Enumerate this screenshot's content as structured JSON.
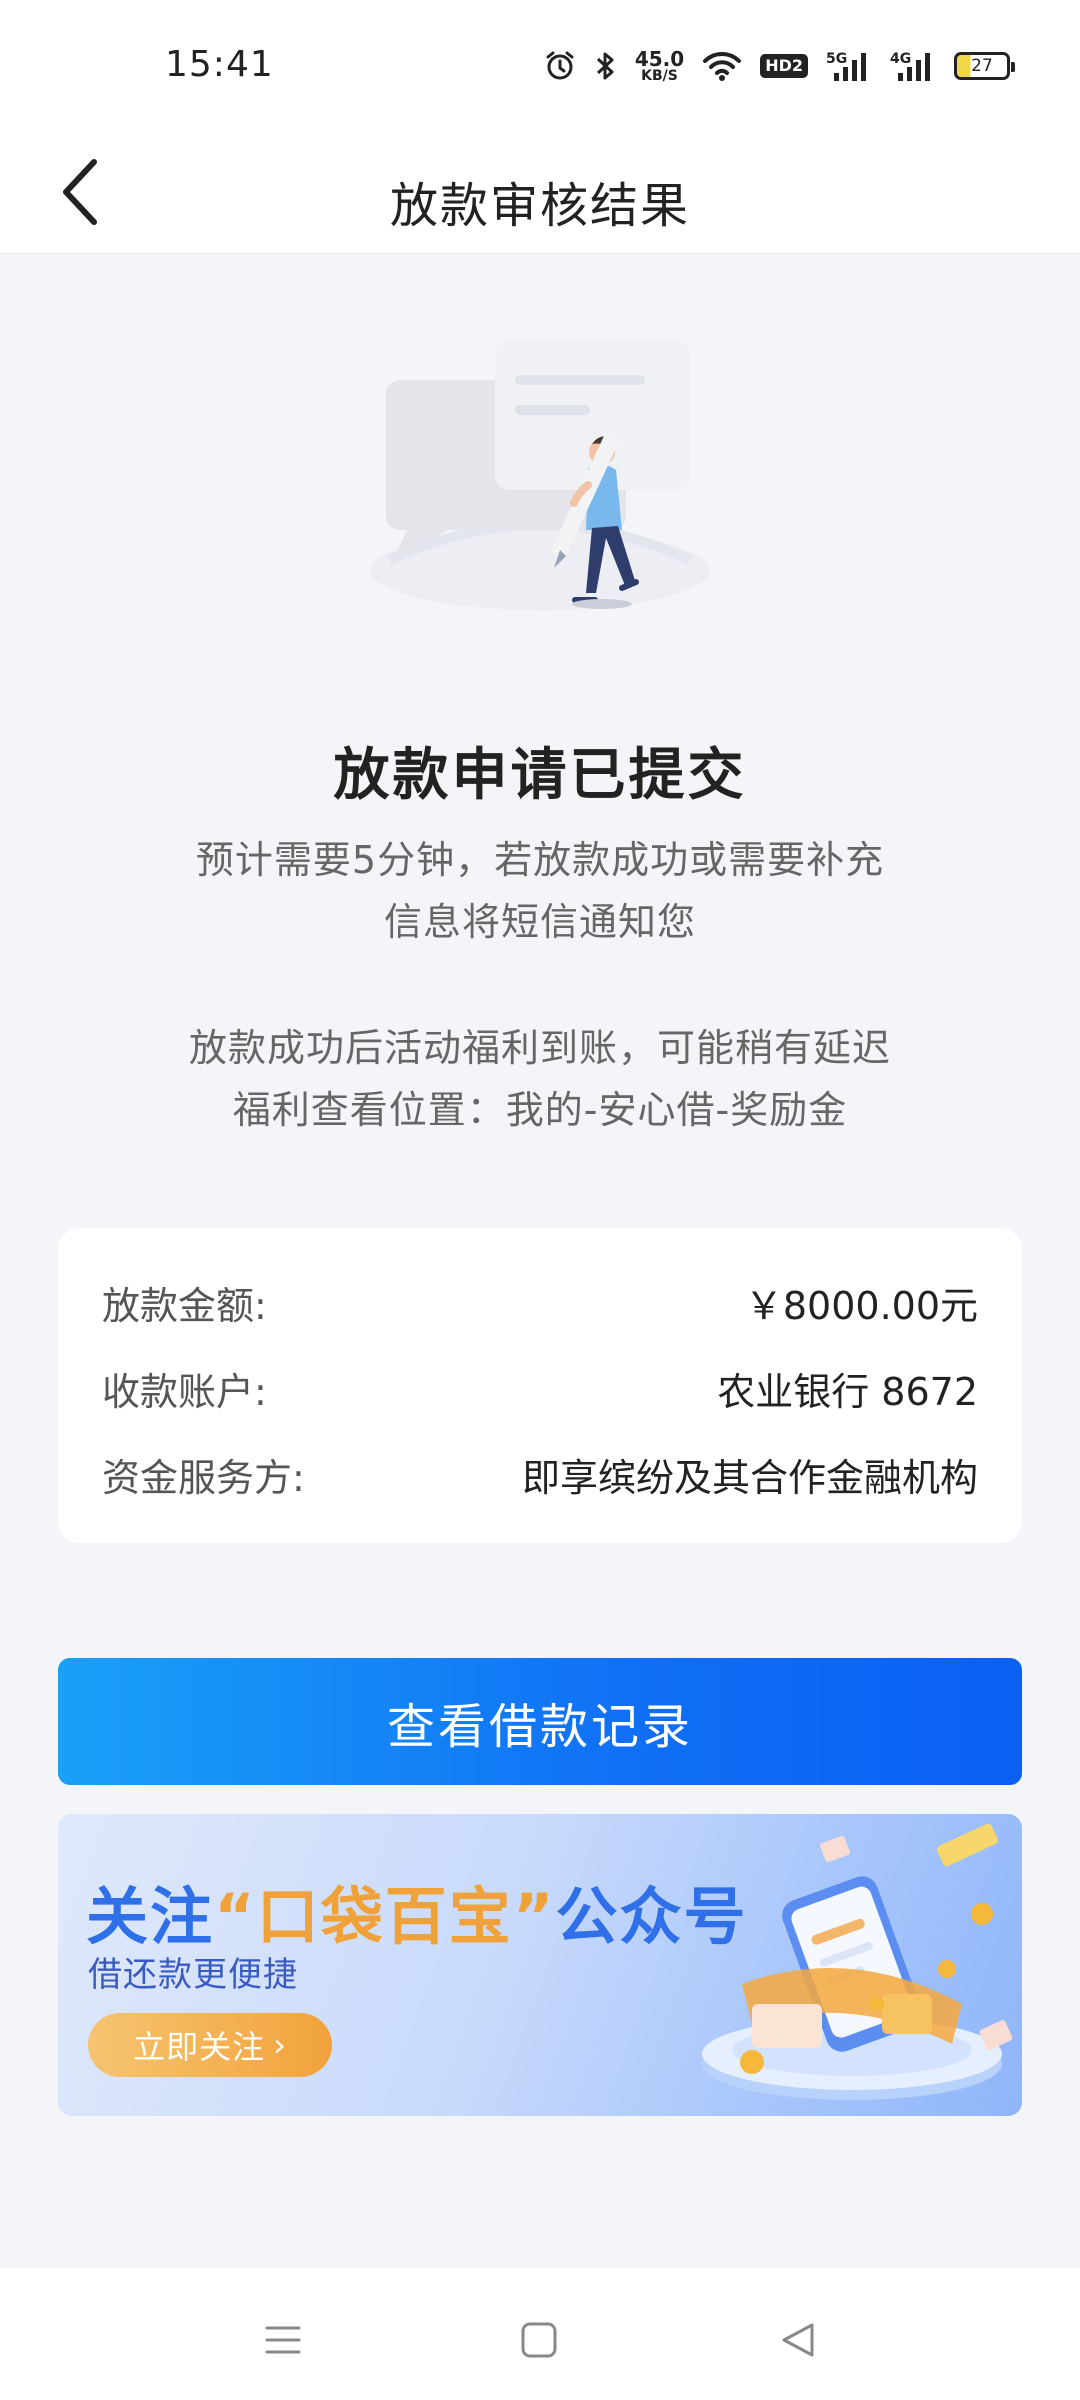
{
  "status_bar": {
    "time": "15:41",
    "net_speed_value": "45.0",
    "net_speed_unit": "KB/S",
    "hd_label": "HD2",
    "signal_5g": "5G",
    "signal_4g": "4G",
    "battery": "27"
  },
  "nav": {
    "title": "放款审核结果"
  },
  "result": {
    "headline": "放款申请已提交",
    "desc_line1": "预计需要5分钟，若放款成功或需要补充",
    "desc_line2": "信息将短信通知您",
    "benefit_line1": "放款成功后活动福利到账，可能稍有延迟",
    "benefit_line2": "福利查看位置：我的-安心借-奖励金"
  },
  "info_card": {
    "rows": [
      {
        "label": "放款金额:",
        "value": "￥8000.00元"
      },
      {
        "label": "收款账户:",
        "value": "农业银行 8672"
      },
      {
        "label": "资金服务方:",
        "value": "即享缤纷及其合作金融机构"
      }
    ]
  },
  "actions": {
    "view_records": "查看借款记录"
  },
  "banner": {
    "title_prefix": "关注",
    "title_highlight": "“口袋百宝”",
    "title_suffix": "公众号",
    "subtitle": "借还款更便捷",
    "button": "立即关注",
    "button_arrow": "›"
  },
  "colors": {
    "primary": "#0f6ff5",
    "background": "#f3f5f9",
    "banner_accent": "#f0a23a"
  }
}
